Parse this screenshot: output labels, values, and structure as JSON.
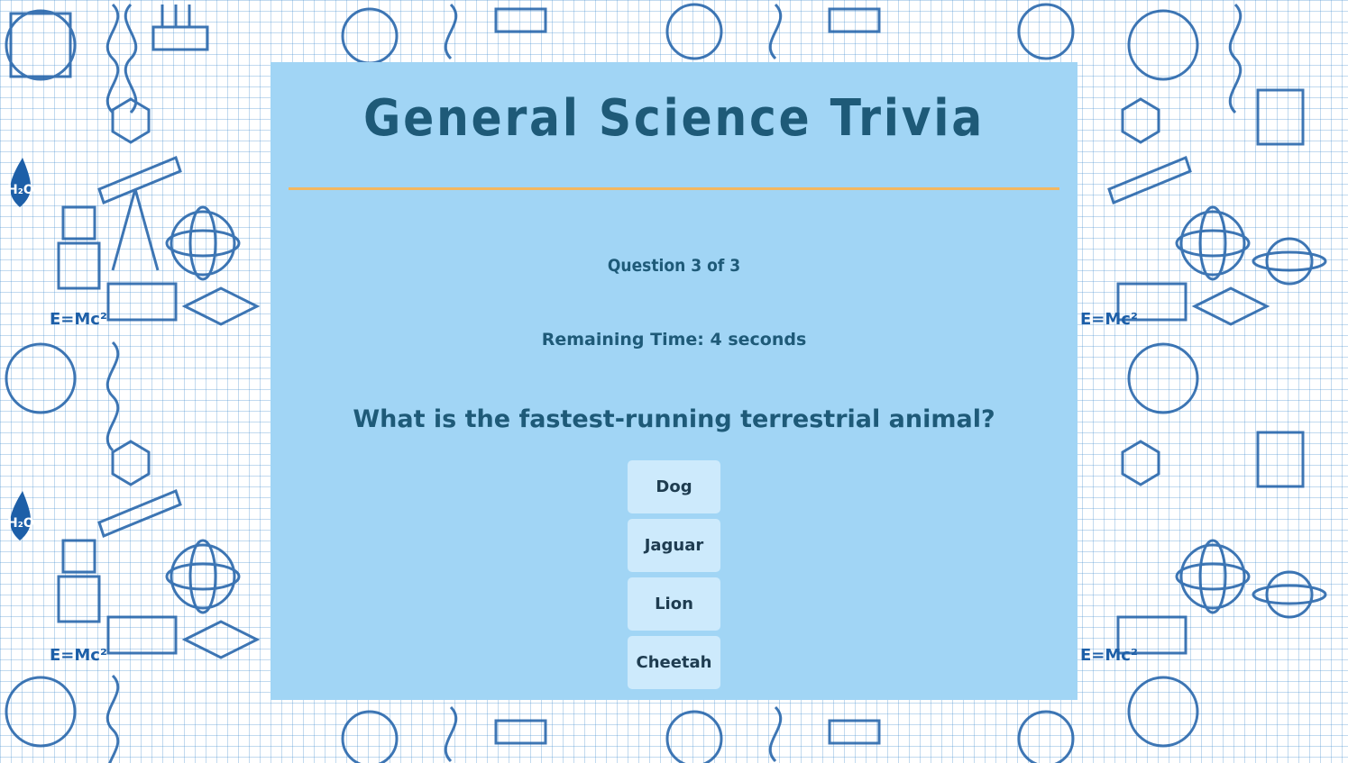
{
  "quiz": {
    "title": "General Science Trivia",
    "question_counter": "Question 3 of 3",
    "remaining_time": "Remaining Time: 4 seconds",
    "question": "What is the fastest-running terrestrial animal?",
    "answers": [
      "Dog",
      "Jaguar",
      "Lion",
      "Cheetah"
    ]
  },
  "colors": {
    "card_background": "#a1d5f5",
    "text_dark_blue": "#1e5a78",
    "divider_orange": "#f3b760",
    "answer_button": "#cdeafc",
    "doodle_blue": "#1d5fa8"
  },
  "background": {
    "texts": [
      "H₂O",
      "E=Mc²"
    ]
  }
}
